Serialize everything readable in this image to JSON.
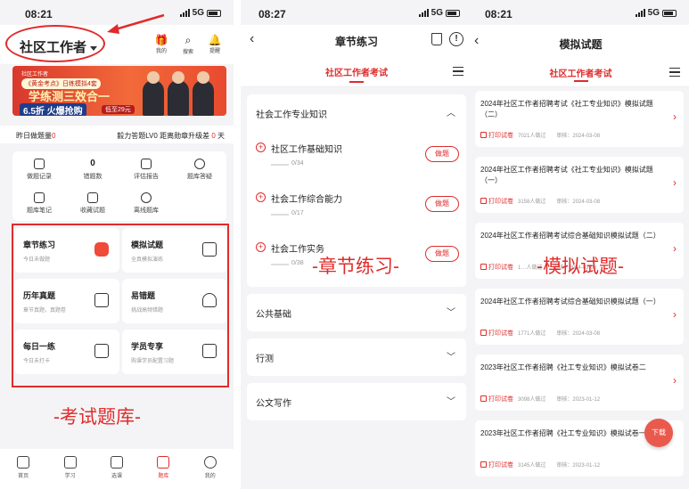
{
  "status": [
    {
      "time": "08:21",
      "network": "5G"
    },
    {
      "time": "08:27",
      "network": "5G"
    },
    {
      "time": "08:21",
      "network": "5G"
    }
  ],
  "home": {
    "title": "社区工作者",
    "header_icons": [
      {
        "icon": "gift-icon",
        "label": "我的"
      },
      {
        "icon": "search-icon",
        "label": "搜索"
      },
      {
        "icon": "bell-icon",
        "label": "提醒"
      }
    ],
    "banner": {
      "brand": "社区工作者",
      "badge": "《黄金考点》日练模拟4套",
      "headline": "学练测三效合一",
      "price_tag": "6.5折 火爆抢购",
      "promo": "低至29元"
    },
    "info": {
      "left_label": "昨日做题量",
      "left_value": "0",
      "right_text": "毅力答题LV0 距离勋章升级差",
      "right_value": "0",
      "right_unit": "天"
    },
    "grid_items": [
      {
        "icon": "record-icon",
        "label": "做题记录"
      },
      {
        "count": "0",
        "label": "错题数"
      },
      {
        "icon": "report-icon",
        "label": "评估报告"
      },
      {
        "icon": "qa-icon",
        "label": "题库答疑"
      },
      {
        "icon": "note-icon",
        "label": "题库笔记"
      },
      {
        "icon": "star-icon",
        "label": "收藏试题"
      },
      {
        "icon": "download-icon",
        "label": "离线题库"
      }
    ],
    "cards": [
      {
        "title": "章节练习",
        "sub": "今日未做题"
      },
      {
        "title": "模拟试题",
        "sub": "全真模拟演练"
      },
      {
        "title": "历年真题",
        "sub": "章节真题，真题卷"
      },
      {
        "title": "易错题",
        "sub": "挑战高频错题"
      },
      {
        "title": "每日一练",
        "sub": "今日未打卡"
      },
      {
        "title": "学员专享",
        "sub": "购课学员配置习题"
      }
    ],
    "annotation": "-考试题库-",
    "tabs": [
      {
        "label": "首页",
        "active": false
      },
      {
        "label": "学习",
        "active": false
      },
      {
        "label": "选课",
        "active": false
      },
      {
        "label": "题库",
        "active": true
      },
      {
        "label": "我的",
        "active": false
      }
    ]
  },
  "chapter": {
    "title": "章节练习",
    "subtab": "社区工作者考试",
    "sections": [
      {
        "title": "社会工作专业知识",
        "expanded": true,
        "items": [
          {
            "name": "社区工作基础知识",
            "progress": "0/34",
            "button": "做题"
          },
          {
            "name": "社会工作综合能力",
            "progress": "0/17",
            "button": "做题"
          },
          {
            "name": "社会工作实务",
            "progress": "0/38",
            "button": "做题"
          }
        ]
      },
      {
        "title": "公共基础",
        "expanded": false
      },
      {
        "title": "行测",
        "expanded": false
      },
      {
        "title": "公文写作",
        "expanded": false
      }
    ],
    "annotation": "-章节练习-"
  },
  "mock": {
    "title": "模拟试题",
    "subtab": "社区工作者考试",
    "items": [
      {
        "title": "2024年社区工作者招聘考试《社工专业知识》模拟试题（二）",
        "print": "打印试卷",
        "reads": "7021人做过",
        "date": "审核：2024-03-08"
      },
      {
        "title": "2024年社区工作者招聘考试《社工专业知识》模拟试题（一）",
        "print": "打印试卷",
        "reads": "3158人做过",
        "date": "审核：2024-03-08"
      },
      {
        "title": "2024年社区工作者招聘考试综合基础知识模拟试题（二）",
        "print": "打印试卷",
        "reads": "1…人做过",
        "date": "审核：2024-03-08"
      },
      {
        "title": "2024年社区工作者招聘考试综合基础知识模拟试题（一）",
        "print": "打印试卷",
        "reads": "1771人做过",
        "date": "审核：2024-03-08"
      },
      {
        "title": "2023年社区工作者招聘《社工专业知识》模拟试卷二",
        "print": "打印试卷",
        "reads": "3098人做过",
        "date": "审核：2023-01-12"
      },
      {
        "title": "2023年社区工作者招聘《社工专业知识》模拟试卷一",
        "print": "打印试卷",
        "reads": "3145人做过",
        "date": "审核：2023-01-12"
      }
    ],
    "annotation": "-模拟试题-",
    "fab": "下载"
  },
  "colors": {
    "accent": "#e02b2b",
    "background": "#f4f4f6"
  }
}
